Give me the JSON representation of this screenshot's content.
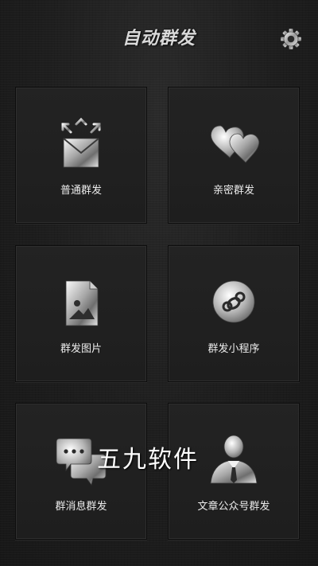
{
  "header": {
    "title": "自动群发"
  },
  "tiles": [
    {
      "label": "普通群发",
      "icon": "envelope-send-icon"
    },
    {
      "label": "亲密群发",
      "icon": "hearts-icon"
    },
    {
      "label": "群发图片",
      "icon": "image-file-icon"
    },
    {
      "label": "群发小程序",
      "icon": "mini-program-icon"
    },
    {
      "label": "群消息群发",
      "icon": "chat-bubbles-icon"
    },
    {
      "label": "文章公众号群发",
      "icon": "official-account-user-icon"
    }
  ],
  "watermark": "五九软件",
  "colors": {
    "background": "#1f1f1f",
    "metal_light": "#f2f2f2",
    "metal_dark": "#6a6a6a"
  }
}
